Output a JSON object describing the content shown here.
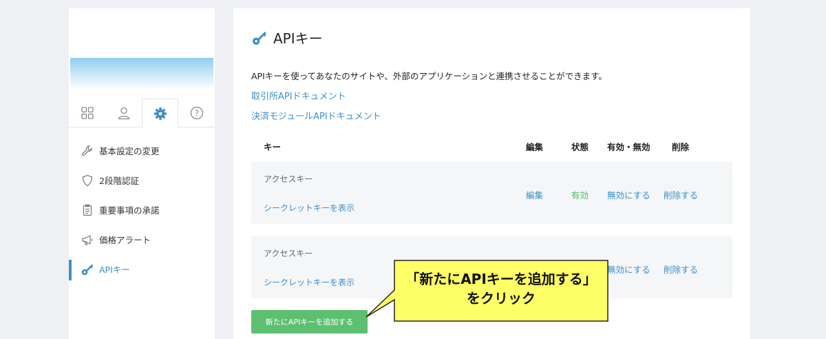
{
  "sidebar": {
    "tabs": [
      {
        "icon": "grid-icon"
      },
      {
        "icon": "user-icon"
      },
      {
        "icon": "gear-icon"
      },
      {
        "icon": "help-icon"
      }
    ],
    "items": [
      {
        "label": "基本設定の変更",
        "icon": "wrench-icon"
      },
      {
        "label": "2段階認証",
        "icon": "shield-icon"
      },
      {
        "label": "重要事項の承諾",
        "icon": "clipboard-icon"
      },
      {
        "label": "価格アラート",
        "icon": "megaphone-icon"
      },
      {
        "label": "APIキー",
        "icon": "key-icon",
        "active": true
      }
    ]
  },
  "main": {
    "title": "APIキー",
    "description": "APIキーを使ってあなたのサイトや、外部のアプリケーションと連携させることができます。",
    "links": [
      "取引所APIドキュメント",
      "決済モジュールAPIドキュメント"
    ],
    "table": {
      "headers": {
        "key": "キー",
        "edit": "編集",
        "status": "状態",
        "toggle": "有効・無効",
        "delete": "削除"
      },
      "rows": [
        {
          "key_label": "アクセスキー",
          "secret_link": "シークレットキーを表示",
          "edit": "編集",
          "status": "有効",
          "toggle": "無効にする",
          "delete": "削除する"
        },
        {
          "key_label": "アクセスキー",
          "secret_link": "シークレットキーを表示",
          "toggle": "無効にする",
          "delete": "削除する"
        }
      ]
    },
    "add_button": "新たにAPIキーを追加する"
  },
  "callout": {
    "line1": "「新たにAPIキーを追加する」",
    "line2": "をクリック"
  },
  "colors": {
    "accent": "#3d8fc8",
    "status_active": "#4cbb6c",
    "button": "#5cc070",
    "callout_bg": "#ffff66"
  }
}
